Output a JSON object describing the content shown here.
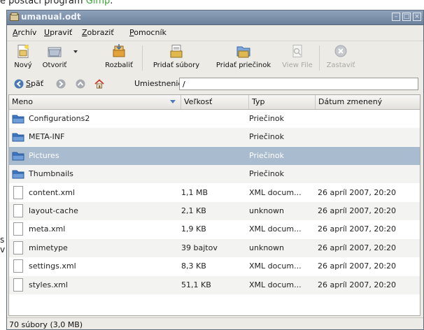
{
  "background": {
    "caption_text": "e postačí program ",
    "caption_link": "Gimp",
    "caption_end": ".",
    "left_fragment_1": "s",
    "left_fragment_2": "v"
  },
  "window": {
    "title": "umanual.odt",
    "controls": [
      "minimize-icon",
      "maximize-icon",
      "close-icon"
    ]
  },
  "menu": [
    {
      "first": "A",
      "rest": "rchív"
    },
    {
      "first": "U",
      "rest": "praviť"
    },
    {
      "first": "Z",
      "rest": "obraziť"
    },
    {
      "first": "P",
      "rest": "omocník"
    }
  ],
  "toolbar": {
    "new": "Nový",
    "open": "Otvoriť",
    "extract": "Rozbaliť",
    "add_files": "Pridať súbory",
    "add_folder": "Pridať priečinok",
    "view_file": "View File",
    "stop": "Zastaviť"
  },
  "location": {
    "back_first": "S",
    "back_rest": "päť",
    "label": "Umiestnenie:",
    "value": "/"
  },
  "columns": {
    "name": "Meno",
    "size": "Veľkosť",
    "type": "Typ",
    "date": "Dátum zmenený"
  },
  "files": [
    {
      "name": "Configurations2",
      "size": "",
      "type": "Priečinok",
      "date": "",
      "icon": "folder-icon"
    },
    {
      "name": "META-INF",
      "size": "",
      "type": "Priečinok",
      "date": "",
      "icon": "folder-icon"
    },
    {
      "name": "Pictures",
      "size": "",
      "type": "Priečinok",
      "date": "",
      "icon": "folder-icon",
      "selected": true
    },
    {
      "name": "Thumbnails",
      "size": "",
      "type": "Priečinok",
      "date": "",
      "icon": "folder-icon"
    },
    {
      "name": "content.xml",
      "size": "1,1 MB",
      "type": "XML docum...",
      "date": "26 apríl 2007, 20:20",
      "icon": "file-icon"
    },
    {
      "name": "layout-cache",
      "size": "2,1 KB",
      "type": "unknown",
      "date": "26 apríl 2007, 20:20",
      "icon": "file-icon"
    },
    {
      "name": "meta.xml",
      "size": "1,9 KB",
      "type": "XML docum...",
      "date": "26 apríl 2007, 20:20",
      "icon": "file-icon"
    },
    {
      "name": "mimetype",
      "size": "39 bajtov",
      "type": "unknown",
      "date": "26 apríl 2007, 20:20",
      "icon": "file-icon"
    },
    {
      "name": "settings.xml",
      "size": "8,3 KB",
      "type": "XML docum...",
      "date": "26 apríl 2007, 20:20",
      "icon": "file-icon"
    },
    {
      "name": "styles.xml",
      "size": "51,1 KB",
      "type": "XML docum...",
      "date": "26 apríl 2007, 20:20",
      "icon": "file-icon"
    }
  ],
  "status": "70 súbory (3,0 MB)",
  "colors": {
    "selection": "#a9bccf",
    "link_green": "#3aa63a",
    "folder_blue": "#3d79c4",
    "titlebar": "#7b8fab"
  }
}
